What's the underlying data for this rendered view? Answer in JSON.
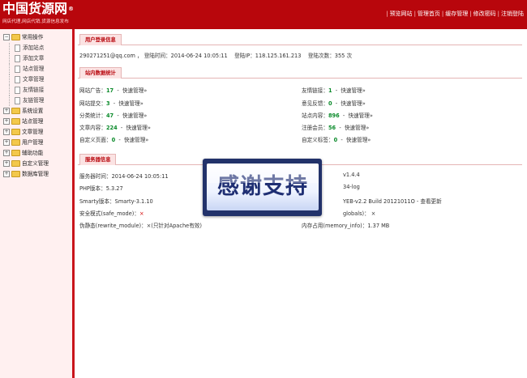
{
  "header": {
    "logo_text": "中国货源网",
    "logo_mark": "®",
    "slogan": "网店代理,网店代销,货源信息发布",
    "links": [
      "预览网站",
      "管理首页",
      "缓存管理",
      "修改密码",
      "注销登陆"
    ]
  },
  "sidebar": {
    "groups": [
      {
        "label": "常用操作",
        "expanded": true,
        "children": [
          "添加站点",
          "添加文章",
          "站点管理",
          "文章管理",
          "友情链接",
          "友链管理"
        ]
      },
      {
        "label": "系统设置",
        "expanded": false
      },
      {
        "label": "站点管理",
        "expanded": false
      },
      {
        "label": "文章管理",
        "expanded": false
      },
      {
        "label": "用户管理",
        "expanded": false
      },
      {
        "label": "辅助功能",
        "expanded": false
      },
      {
        "label": "自定义管理",
        "expanded": false
      },
      {
        "label": "数据库管理",
        "expanded": false
      }
    ]
  },
  "login_info": {
    "title": "用户登录信息",
    "account": "290271251@qq.com",
    "time_label": "登陆时间：",
    "time": "2014-06-24 10:05:11",
    "ip_label": "登陆IP：",
    "ip": "118.125.161.213",
    "count_label": "登陆次数：",
    "count": "355",
    "count_unit": "次"
  },
  "stats": {
    "title": "站内数据统计",
    "quick": "快速管理»",
    "left": [
      {
        "label": "网站广告：",
        "value": "17"
      },
      {
        "label": "网站提交：",
        "value": "3"
      },
      {
        "label": "分类统计：",
        "value": "47"
      },
      {
        "label": "文章内容：",
        "value": "224"
      },
      {
        "label": "自定义页面：",
        "value": "0"
      }
    ],
    "right": [
      {
        "label": "友情链接：",
        "value": "1"
      },
      {
        "label": "意见反馈：",
        "value": "0"
      },
      {
        "label": "站点内容：",
        "value": "896"
      },
      {
        "label": "注册会员：",
        "value": "56"
      },
      {
        "label": "自定义标签：",
        "value": "0"
      }
    ]
  },
  "server": {
    "title": "服务器信息",
    "left": [
      {
        "label": "服务器时间：",
        "value": "2014-06-24   10:05:11"
      },
      {
        "label": "PHP版本：",
        "value": "5.3.27"
      },
      {
        "label": "Smarty版本：",
        "value": "Smarty-3.1.10"
      },
      {
        "label": "安全模式(safe_mode)：",
        "value": "×"
      },
      {
        "label": "伪静态(rewrite_module)：",
        "value": "×(只针对Apache有效)"
      }
    ],
    "right": [
      {
        "value": "v1.4.4"
      },
      {
        "value": "34-log"
      },
      {
        "value": "YEB-v2.2 Build 20121011O - 查看更新"
      },
      {
        "value": "globals)： ×"
      },
      {
        "label": "内存占用(memory_info)：",
        "value": "1.37 MB"
      }
    ]
  },
  "overlay": {
    "text": "感谢支持"
  }
}
